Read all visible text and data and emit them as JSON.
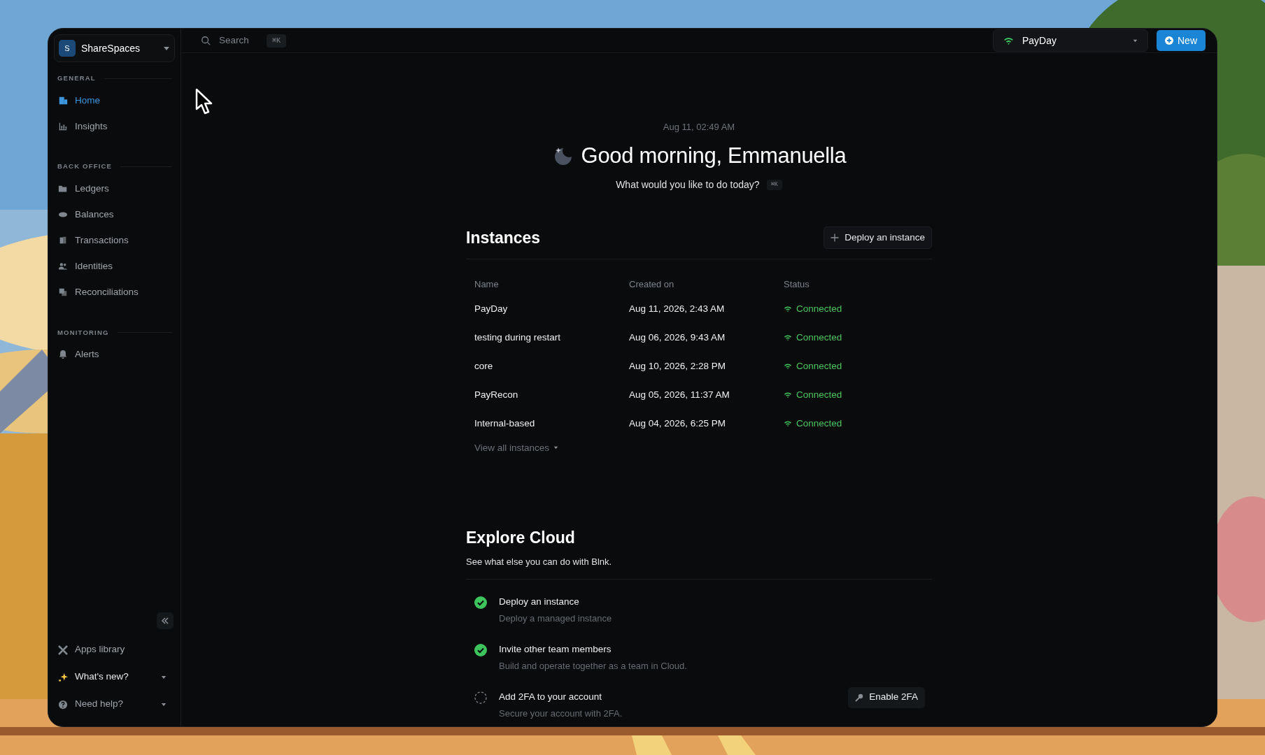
{
  "workspace": {
    "initial": "S",
    "name": "ShareSpaces"
  },
  "search": {
    "placeholder": "Search",
    "shortcut": "⌘K"
  },
  "instance_selector": {
    "label": "PayDay"
  },
  "new_button": {
    "label": "New"
  },
  "sidebar": {
    "sections": [
      {
        "title": "GENERAL",
        "items": [
          {
            "label": "Home",
            "selected": true
          },
          {
            "label": "Insights",
            "selected": false
          }
        ]
      },
      {
        "title": "BACK OFFICE",
        "items": [
          {
            "label": "Ledgers",
            "selected": false
          },
          {
            "label": "Balances",
            "selected": false
          },
          {
            "label": "Transactions",
            "selected": false
          },
          {
            "label": "Identities",
            "selected": false
          },
          {
            "label": "Reconciliations",
            "selected": false
          }
        ]
      },
      {
        "title": "MONITORING",
        "items": [
          {
            "label": "Alerts",
            "selected": false
          }
        ]
      }
    ],
    "footer": [
      {
        "label": "Apps library",
        "kind": "link"
      },
      {
        "label": "What's new?",
        "kind": "menu"
      },
      {
        "label": "Need help?",
        "kind": "menu"
      }
    ]
  },
  "greeting": {
    "date": "Aug 11, 02:49 AM",
    "title": "Good morning, Emmanuella",
    "prompt": "What would you like to do today?",
    "shortcut": "⌘K"
  },
  "instances": {
    "title": "Instances",
    "deploy_button": "Deploy an instance",
    "columns": [
      "Name",
      "Created on",
      "Status"
    ],
    "rows": [
      {
        "name": "PayDay",
        "created": "Aug 11, 2026, 2:43 AM",
        "status": "Connected"
      },
      {
        "name": "testing during restart",
        "created": "Aug 06, 2026, 9:43 AM",
        "status": "Connected"
      },
      {
        "name": "core",
        "created": "Aug 10, 2026, 2:28 PM",
        "status": "Connected"
      },
      {
        "name": "PayRecon",
        "created": "Aug 05, 2026, 11:37 AM",
        "status": "Connected"
      },
      {
        "name": "Internal-based",
        "created": "Aug 04, 2026, 6:25 PM",
        "status": "Connected"
      }
    ],
    "view_all": "View all instances"
  },
  "explore": {
    "title": "Explore Cloud",
    "subtitle": "See what else you can do with Blnk.",
    "tasks": [
      {
        "title": "Deploy an instance",
        "description": "Deploy a managed instance",
        "done": true
      },
      {
        "title": "Invite other team members",
        "description": "Build and operate together as a team in Cloud.",
        "done": true
      },
      {
        "title": "Add 2FA to your account",
        "description": "Secure your account with 2FA.",
        "done": false,
        "action": "Enable 2FA"
      }
    ]
  }
}
